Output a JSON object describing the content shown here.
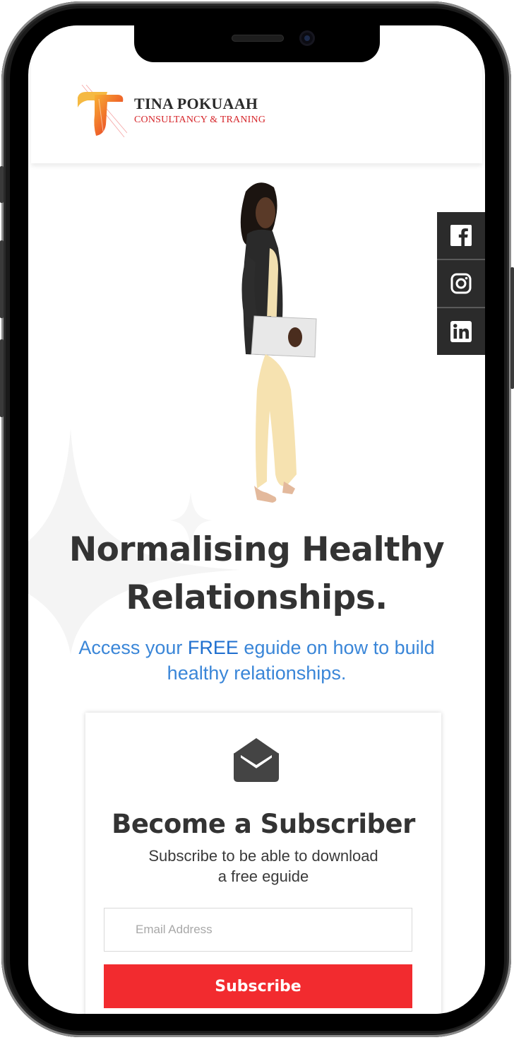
{
  "header": {
    "brand_name": "TINA POKUAAH",
    "brand_tagline": "CONSULTANCY & TRANING"
  },
  "social": [
    {
      "name": "facebook-icon",
      "glyph": "f"
    },
    {
      "name": "instagram-icon",
      "glyph": "instagram"
    },
    {
      "name": "linkedin-icon",
      "glyph": "in"
    }
  ],
  "hero": {
    "headline_line1": "Normalising Healthy",
    "headline_line2": "Relationships.",
    "subhead_before": "Access your ",
    "subhead_emphasis": "FREE",
    "subhead_after": " eguide on how to build healthy relationships."
  },
  "subscribe": {
    "title": "Become a Subscriber",
    "subtitle_line1": "Subscribe to be able to download",
    "subtitle_line2": "a free eguide",
    "email_placeholder": "Email Address",
    "button_label": "Subscribe"
  },
  "colors": {
    "accent_blue": "#3a86d8",
    "cta_red": "#f22b2f",
    "brand_red": "#d6262b",
    "dark_text": "#333333",
    "social_bg": "#2b2b2b"
  }
}
